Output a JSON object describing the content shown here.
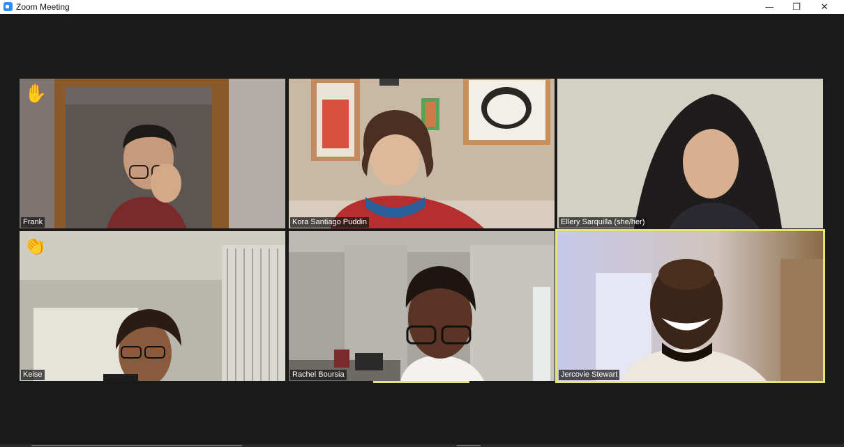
{
  "window": {
    "title": "Zoom Meeting",
    "controls": {
      "minimize": "—",
      "restore": "❐",
      "close": "✕"
    }
  },
  "participants": [
    {
      "name": "Frank",
      "reaction": "raised-hand",
      "reaction_glyph": "✋"
    },
    {
      "name": "Kora Santiago Puddin"
    },
    {
      "name": "Ellery Sarquilla (she/her)"
    },
    {
      "name": "Keise",
      "reaction": "clap",
      "reaction_glyph": "👏"
    },
    {
      "name": "Rachel Boursia"
    },
    {
      "name": "Jercovie Stewart",
      "active_speaker": true
    }
  ],
  "colors": {
    "background": "#1a1a1a",
    "active_speaker_border": "#e6e673",
    "titlebar": "#ffffff"
  }
}
